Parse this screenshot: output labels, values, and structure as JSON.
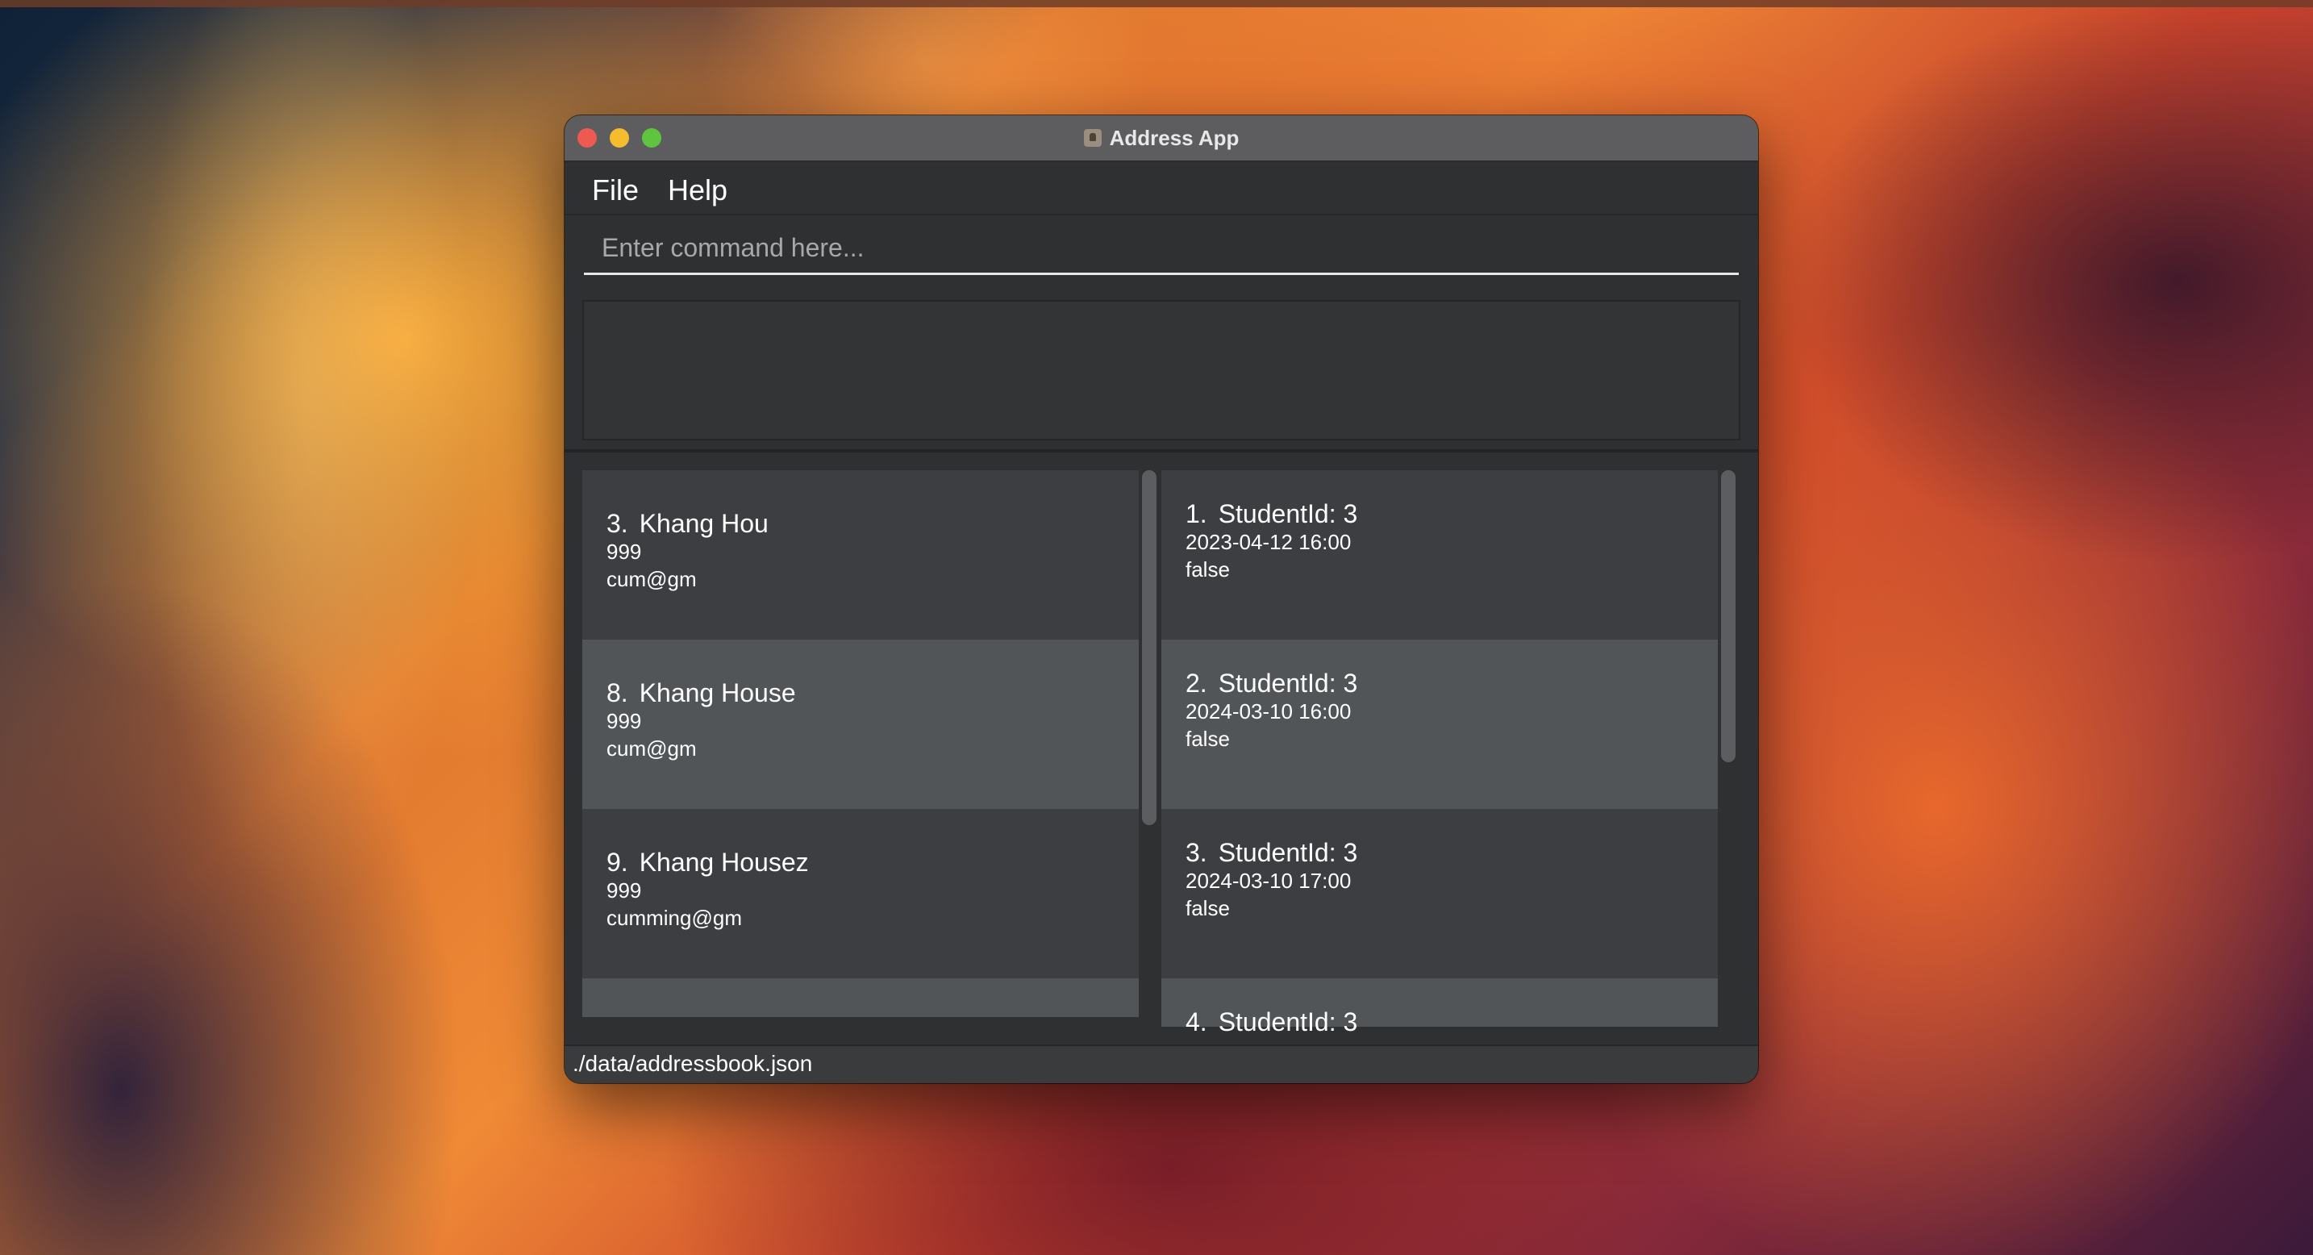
{
  "window": {
    "title": "Address App"
  },
  "menu": {
    "file": "File",
    "help": "Help"
  },
  "command": {
    "placeholder": "Enter command here...",
    "value": ""
  },
  "result": {
    "text": ""
  },
  "persons": [
    {
      "index": "3.",
      "name": "Khang Hou",
      "phone": "999",
      "email": "cum@gm"
    },
    {
      "index": "8.",
      "name": "Khang House",
      "phone": "999",
      "email": "cum@gm"
    },
    {
      "index": "9.",
      "name": "Khang Housez",
      "phone": "999",
      "email": "cumming@gm"
    }
  ],
  "sessions": [
    {
      "index": "1.",
      "title": "StudentId: 3",
      "datetime": "2023-04-12 16:00",
      "status": "false"
    },
    {
      "index": "2.",
      "title": "StudentId: 3",
      "datetime": "2024-03-10 16:00",
      "status": "false"
    },
    {
      "index": "3.",
      "title": "StudentId: 3",
      "datetime": "2024-03-10 17:00",
      "status": "false"
    },
    {
      "index": "4.",
      "title": "StudentId: 3",
      "datetime": "",
      "status": ""
    }
  ],
  "status_bar": {
    "path": "./data/addressbook.json"
  },
  "colors": {
    "window_bg": "#2f3032",
    "titlebar": "#5d5c5e",
    "card_odd": "#3c3e41",
    "card_even": "#515558",
    "close": "#ee5a52",
    "minimize": "#f5bd2e",
    "maximize": "#5fc53f"
  }
}
